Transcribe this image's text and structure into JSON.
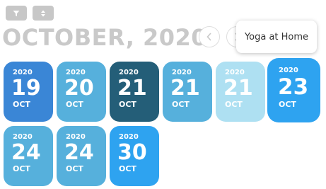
{
  "toolbar": {
    "filter_icon": "filter-icon",
    "sort_icon": "sort-icon"
  },
  "header": {
    "month_title": "OCTOBER, 2020",
    "prev_icon": "chevron-left-icon",
    "next_icon": "chevron-right-icon"
  },
  "tooltip": {
    "text": "Yoga at Home"
  },
  "dates": [
    {
      "year": "2020",
      "day": "19",
      "month": "OCT",
      "color": "#3a86d6"
    },
    {
      "year": "2020",
      "day": "20",
      "month": "OCT",
      "color": "#56b0dc"
    },
    {
      "year": "2020",
      "day": "21",
      "month": "OCT",
      "color": "#245e78"
    },
    {
      "year": "2020",
      "day": "21",
      "month": "OCT",
      "color": "#56b0dc"
    },
    {
      "year": "2020",
      "day": "21",
      "month": "OCT",
      "color": "#aee0f2"
    },
    {
      "year": "2020",
      "day": "23",
      "month": "OCT",
      "color": "#2ea3f0"
    },
    {
      "year": "2020",
      "day": "24",
      "month": "OCT",
      "color": "#56b0dc"
    },
    {
      "year": "2020",
      "day": "24",
      "month": "OCT",
      "color": "#56b0dc"
    },
    {
      "year": "2020",
      "day": "30",
      "month": "OCT",
      "color": "#2ea3f0"
    }
  ]
}
